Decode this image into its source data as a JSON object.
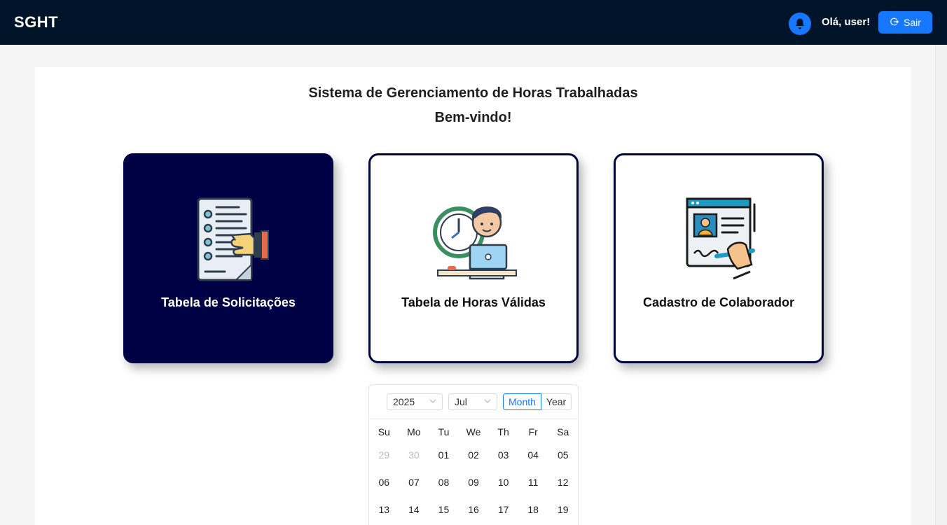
{
  "header": {
    "brand": "SGHT",
    "greeting": "Olá, user!",
    "logout_label": "Sair",
    "bg_color": "#001529",
    "accent_color": "#1677ff"
  },
  "main": {
    "title": "Sistema de Gerenciamento de Horas Trabalhadas",
    "subtitle": "Bem-vindo!"
  },
  "cards": [
    {
      "label": "Tabela de Solicitações",
      "icon": "document-request-icon",
      "theme": "dark"
    },
    {
      "label": "Tabela de Horas Válidas",
      "icon": "worker-clock-icon",
      "theme": "light"
    },
    {
      "label": "Cadastro de Colaborador",
      "icon": "profile-signing-icon",
      "theme": "light"
    }
  ],
  "calendar": {
    "year": "2025",
    "month": "Jul",
    "mode_month": "Month",
    "mode_year": "Year",
    "weekdays": [
      "Su",
      "Mo",
      "Tu",
      "We",
      "Th",
      "Fr",
      "Sa"
    ],
    "weeks": [
      [
        "29",
        "30",
        "01",
        "02",
        "03",
        "04",
        "05"
      ],
      [
        "06",
        "07",
        "08",
        "09",
        "10",
        "11",
        "12"
      ],
      [
        "13",
        "14",
        "15",
        "16",
        "17",
        "18",
        "19"
      ]
    ]
  }
}
